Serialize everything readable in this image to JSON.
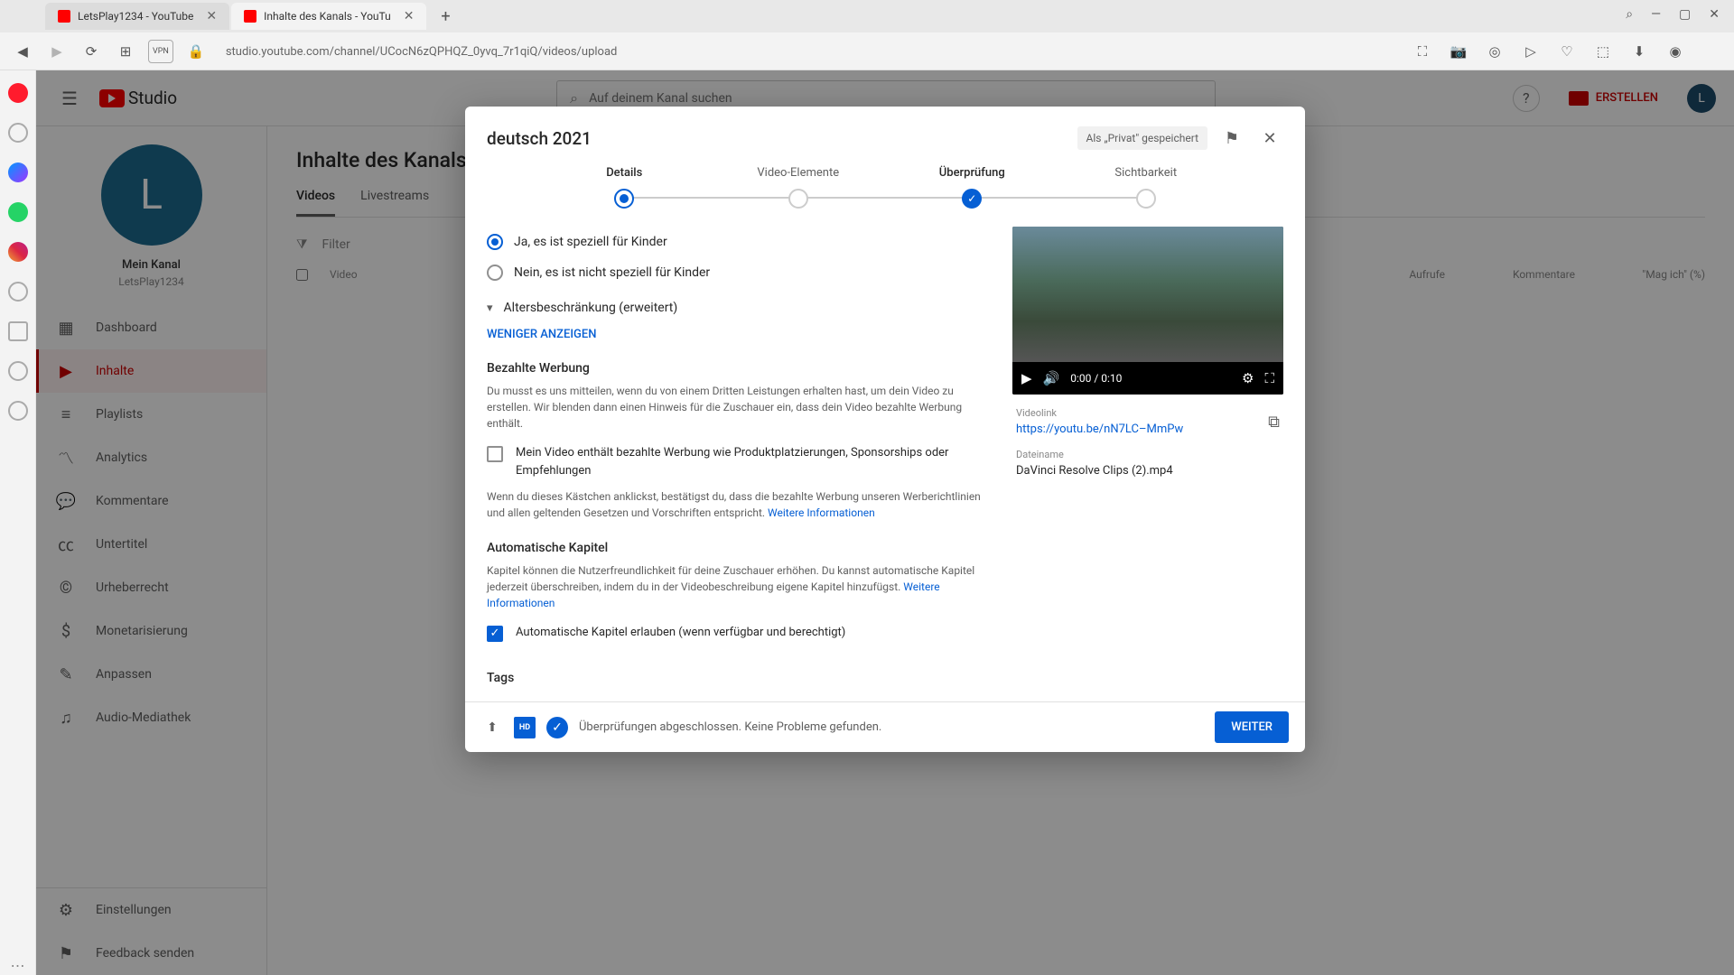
{
  "browser": {
    "tabs": [
      {
        "title": "LetsPlay1234 - YouTube",
        "active": false
      },
      {
        "title": "Inhalte des Kanals - YouTu",
        "active": true
      }
    ],
    "url": "studio.youtube.com/channel/UCocN6zQPHQZ_0yvq_7r1qiQ/videos/upload",
    "vpn": "VPN"
  },
  "header": {
    "logo": "Studio",
    "search_placeholder": "Auf deinem Kanal suchen",
    "create": "ERSTELLEN",
    "avatar": "L"
  },
  "sidebar": {
    "channel_initial": "L",
    "channel_name": "Mein Kanal",
    "channel_sub": "LetsPlay1234",
    "items": [
      {
        "icon": "▦",
        "label": "Dashboard"
      },
      {
        "icon": "▶",
        "label": "Inhalte"
      },
      {
        "icon": "≡",
        "label": "Playlists"
      },
      {
        "icon": "〽",
        "label": "Analytics"
      },
      {
        "icon": "💬",
        "label": "Kommentare"
      },
      {
        "icon": "㏄",
        "label": "Untertitel"
      },
      {
        "icon": "©",
        "label": "Urheberrecht"
      },
      {
        "icon": "$",
        "label": "Monetarisierung"
      },
      {
        "icon": "✎",
        "label": "Anpassen"
      },
      {
        "icon": "♫",
        "label": "Audio-Mediathek"
      }
    ],
    "footer": [
      {
        "icon": "⚙",
        "label": "Einstellungen"
      },
      {
        "icon": "⚑",
        "label": "Feedback senden"
      }
    ]
  },
  "main": {
    "title": "Inhalte des Kanals",
    "tabs": [
      "Videos",
      "Livestreams"
    ],
    "filter": "Filter",
    "col_video": "Video",
    "col_views": "Aufrufe",
    "col_comments": "Kommentare",
    "col_likes": "\"Mag ich\" (%)"
  },
  "modal": {
    "title": "deutsch 2021",
    "save_status": "Als „Privat\" gespeichert",
    "steps": [
      "Details",
      "Video-Elemente",
      "Überprüfung",
      "Sichtbarkeit"
    ],
    "radio_yes": "Ja, es ist speziell für Kinder",
    "radio_no": "Nein, es ist nicht speziell für Kinder",
    "age_restriction": "Altersbeschränkung (erweitert)",
    "show_less": "WENIGER ANZEIGEN",
    "paid_title": "Bezahlte Werbung",
    "paid_desc": "Du musst es uns mitteilen, wenn du von einem Dritten Leistungen erhalten hast, um dein Video zu erstellen. Wir blenden dann einen Hinweis für die Zuschauer ein, dass dein Video bezahlte Werbung enthält.",
    "paid_checkbox": "Mein Video enthält bezahlte Werbung wie Produktplatzierungen, Sponsorships oder Empfehlungen",
    "paid_confirm": "Wenn du dieses Kästchen anklickst, bestätigst du, dass die bezahlte Werbung unseren Werberichtlinien und allen geltenden Gesetzen und Vorschriften entspricht. ",
    "more_info": "Weitere Informationen",
    "chapters_title": "Automatische Kapitel",
    "chapters_desc": "Kapitel können die Nutzerfreundlichkeit für deine Zuschauer erhöhen. Du kannst automatische Kapitel jederzeit überschreiben, indem du in der Videobeschreibung eigene Kapitel hinzufügst. ",
    "chapters_checkbox": "Automatische Kapitel erlauben (wenn verfügbar und berechtigt)",
    "tags_title": "Tags",
    "video": {
      "time": "0:00 / 0:10",
      "link_label": "Videolink",
      "link": "https://youtu.be/nN7LC–MmPw",
      "filename_label": "Dateiname",
      "filename": "DaVinci Resolve Clips (2).mp4"
    },
    "footer_status": "Überprüfungen abgeschlossen. Keine Probleme gefunden.",
    "next": "WEITER"
  }
}
